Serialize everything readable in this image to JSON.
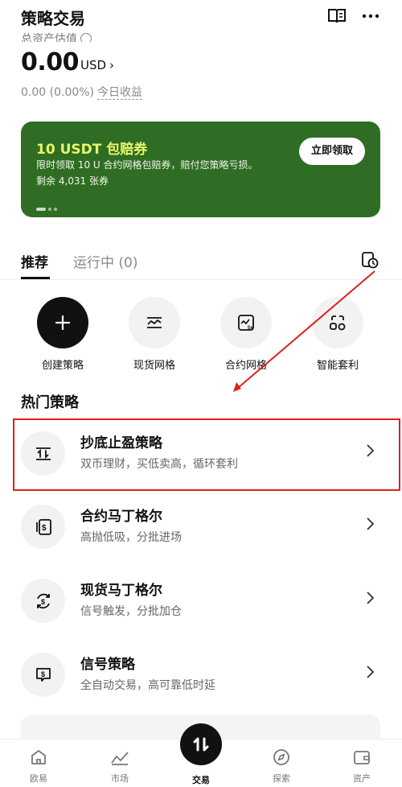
{
  "header": {
    "title": "策略交易"
  },
  "asset": {
    "label": "总资产估值",
    "value": "0.00",
    "unit": "USD",
    "chevron": "›",
    "pnl": "0.00 (0.00%)",
    "pnl_label": "今日收益"
  },
  "banner": {
    "title": "10 USDT 包赔券",
    "desc": "限时领取 10 U 合约网格包赔券，赔付您策略亏损。",
    "remaining": "剩余 4,031 张券",
    "button": "立即领取",
    "bg_color": "#2f6d24",
    "accent_color": "#e8f66c"
  },
  "tabs": [
    {
      "label": "推荐"
    },
    {
      "label": "运行中 (0)"
    }
  ],
  "quick_actions": [
    {
      "label": "创建策略",
      "icon": "plus-icon"
    },
    {
      "label": "现货网格",
      "icon": "spot-grid-icon"
    },
    {
      "label": "合约网格",
      "icon": "futures-grid-icon"
    },
    {
      "label": "智能套利",
      "icon": "smart-arbitrage-icon"
    }
  ],
  "hot_title": "热门策略",
  "strategies": [
    {
      "name": "抄底止盈策略",
      "desc": "双币理财，买低卖高，循环套利",
      "icon": "buy-low-icon"
    },
    {
      "name": "合约马丁格尔",
      "desc": "高抛低吸，分批进场",
      "icon": "futures-martingale-icon"
    },
    {
      "name": "现货马丁格尔",
      "desc": "信号触发，分批加仓",
      "icon": "spot-martingale-icon"
    },
    {
      "name": "信号策略",
      "desc": "全自动交易，高可靠低时延",
      "icon": "signal-icon"
    }
  ],
  "bottom_nav": [
    {
      "label": "欧易",
      "icon": "home-icon"
    },
    {
      "label": "市场",
      "icon": "market-icon"
    },
    {
      "label": "交易",
      "icon": "trade-icon"
    },
    {
      "label": "探索",
      "icon": "compass-icon"
    },
    {
      "label": "资产",
      "icon": "wallet-icon"
    }
  ],
  "annotation_color": "#e02020"
}
